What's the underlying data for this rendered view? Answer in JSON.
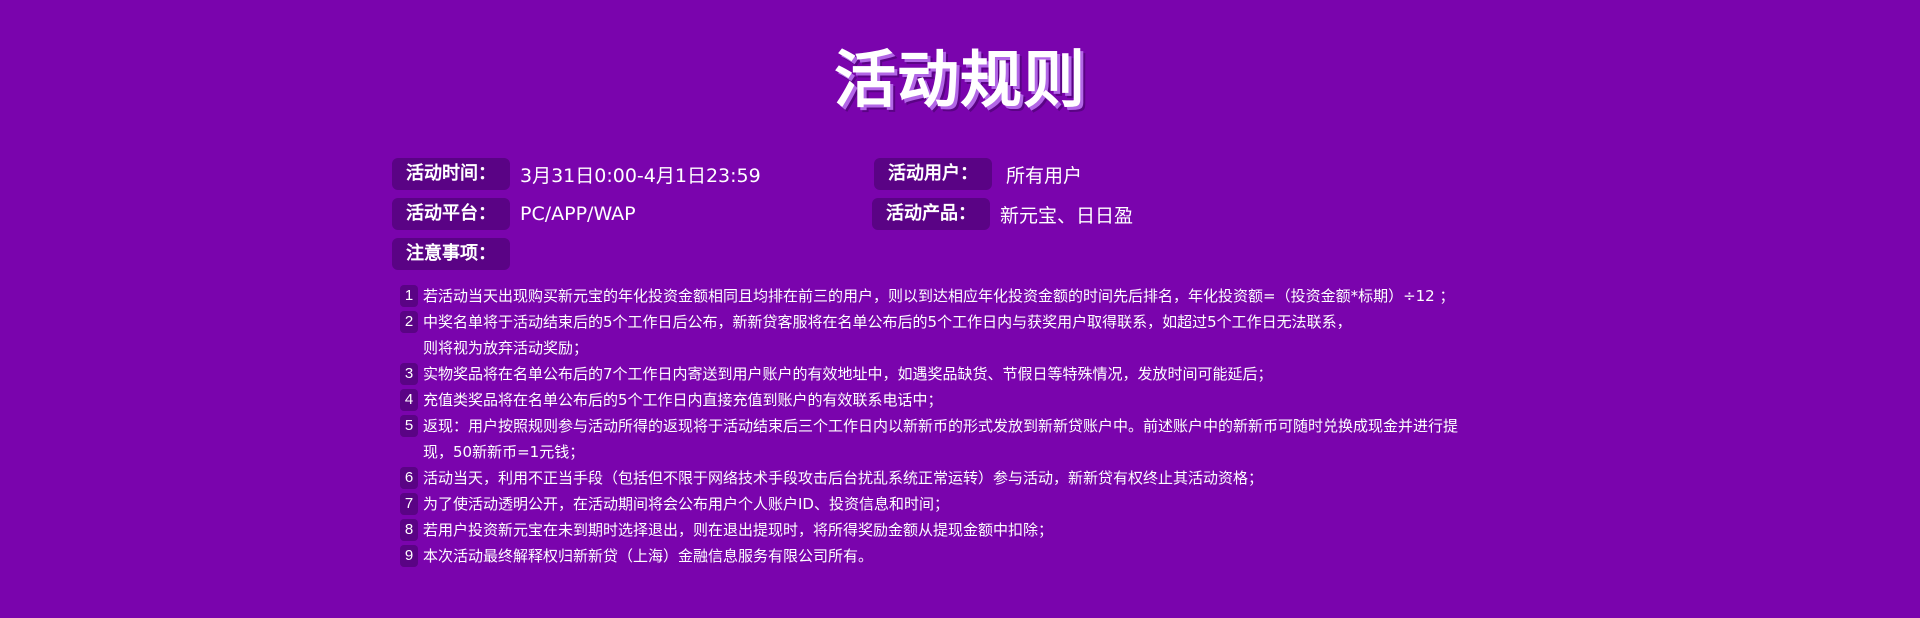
{
  "page": {
    "title": "活动规则"
  },
  "info": {
    "time": {
      "label": "活动时间：",
      "value": "3月31日0:00-4月1日23:59"
    },
    "users": {
      "label": "活动用户：",
      "value": "所有用户"
    },
    "platform": {
      "label": "活动平台：",
      "value": "PC/APP/WAP"
    },
    "products": {
      "label": "活动产品：",
      "value": "新元宝、日日盈"
    },
    "notes": {
      "label": "注意事项："
    }
  },
  "rules": [
    {
      "num": "1",
      "lines": [
        "若活动当天出现购买新元宝的年化投资金额相同且均排在前三的用户，则以到达相应年化投资金额的时间先后排名，年化投资额=（投资金额*标期）÷12 ；"
      ]
    },
    {
      "num": "2",
      "lines": [
        "中奖名单将于活动结束后的5个工作日后公布，新新贷客服将在名单公布后的5个工作日内与获奖用户取得联系，如超过5个工作日无法联系，",
        "则将视为放弃活动奖励；"
      ]
    },
    {
      "num": "3",
      "lines": [
        "实物奖品将在名单公布后的7个工作日内寄送到用户账户的有效地址中，如遇奖品缺货、节假日等特殊情况，发放时间可能延后；"
      ]
    },
    {
      "num": "4",
      "lines": [
        "充值类奖品将在名单公布后的5个工作日内直接充值到账户的有效联系电话中；"
      ]
    },
    {
      "num": "5",
      "lines": [
        "返现：用户按照规则参与活动所得的返现将于活动结束后三个工作日内以新新币的形式发放到新新贷账户中。前述账户中的新新币可随时兑换成现金并进行提",
        "现，50新新币=1元钱；"
      ]
    },
    {
      "num": "6",
      "lines": [
        "活动当天，利用不正当手段（包括但不限于网络技术手段攻击后台扰乱系统正常运转）参与活动，新新贷有权终止其活动资格；"
      ]
    },
    {
      "num": "7",
      "lines": [
        "为了使活动透明公开，在活动期间将会公布用户个人账户ID、投资信息和时间；"
      ]
    },
    {
      "num": "8",
      "lines": [
        "若用户投资新元宝在未到期时选择退出，则在退出提现时，将所得奖励金额从提现金额中扣除；"
      ]
    },
    {
      "num": "9",
      "lines": [
        "本次活动最终解释权归新新贷（上海）金融信息服务有限公司所有。"
      ]
    }
  ]
}
